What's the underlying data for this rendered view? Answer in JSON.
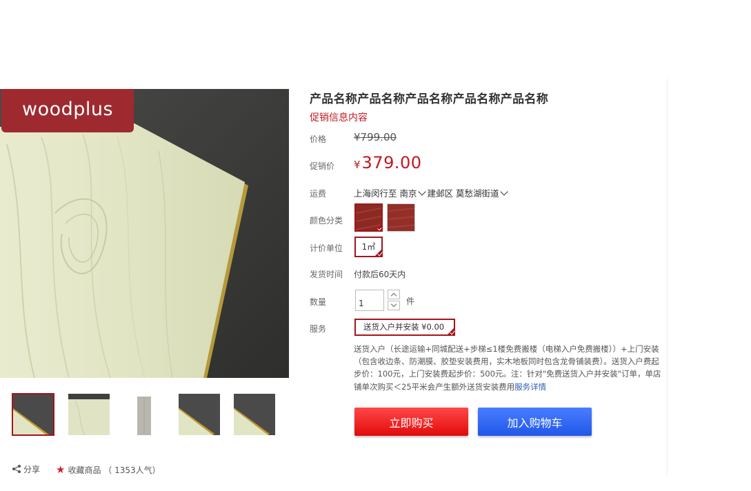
{
  "brand": {
    "logo_text": "woodplus"
  },
  "product": {
    "title": "产品名称产品名称产品名称产品名称产品名称",
    "promo_text": "促销信息内容"
  },
  "price": {
    "label": "价格",
    "original": "¥799.00",
    "sale_label": "促销价",
    "sale_currency": "¥",
    "sale_value": "379.00"
  },
  "shipping": {
    "label": "运费",
    "origin": "上海闵行至",
    "city": "南京",
    "district": "建邺区",
    "street": "莫愁湖街道"
  },
  "color": {
    "label": "颜色分类",
    "selected_index": 0
  },
  "unit": {
    "label": "计价单位",
    "value": "1㎡"
  },
  "delivery": {
    "label": "发货时间",
    "value": "付款后60天内"
  },
  "quantity": {
    "label": "数量",
    "value": "1",
    "unit": "件"
  },
  "service": {
    "label": "服务",
    "option": "送货入户并安装 ¥0.00",
    "description": "送货入户（长途运输+同城配送+步梯≤1楼免费搬楼（电梯入户免费搬楼））+上门安装（包含收边条、防潮膜、胶垫安装费用，实木地板同时包含龙骨铺装费）。送货入户费起步价：100元，上门安装费起步价：500元。注：针对\"免费送货入户并安装\"订单，单店铺单次购买＜25平米会产生额外送货安装费用",
    "detail_link": "服务详情"
  },
  "actions": {
    "buy_now": "立即购买",
    "add_to_cart": "加入购物车"
  },
  "social": {
    "share": "分享",
    "favorite": "收藏商品",
    "popularity": "（ 1353人气）"
  },
  "colors": {
    "accent": "#c0181f",
    "selected_border": "#a3141b",
    "buy_button": "#f02020",
    "cart_button": "#2d63f0"
  }
}
